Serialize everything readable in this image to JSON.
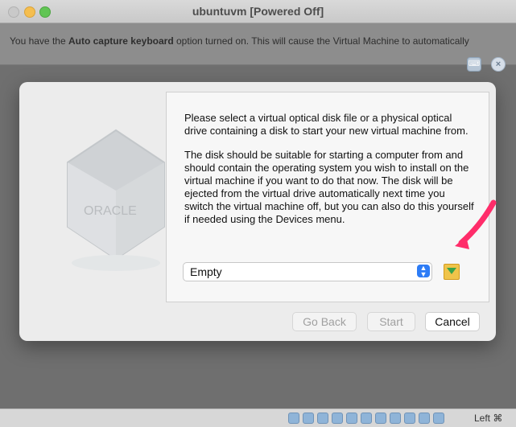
{
  "window": {
    "title": "ubuntuvm [Powered Off]"
  },
  "notice": {
    "text_before": "You have the ",
    "bold_text": "Auto capture keyboard",
    "text_after": " option turned on. This will cause the Virtual Machine to automatically"
  },
  "dialog": {
    "paragraph1": "Please select a virtual optical disk file or a physical optical drive containing a disk to start your new virtual machine from.",
    "paragraph2": "The disk should be suitable for starting a computer from and should contain the operating system you wish to install on the virtual machine if you want to do that now. The disk will be ejected from the virtual drive automatically next time you switch the virtual machine off, but you can also do this yourself if needed using the Devices menu.",
    "select_value": "Empty",
    "buttons": {
      "back": "Go Back",
      "start": "Start",
      "cancel": "Cancel"
    },
    "logo_text": "ORACLE"
  },
  "status_bar": {
    "host_key": "Left ⌘"
  },
  "colors": {
    "annotation_arrow": "#ff2d6a",
    "select_button": "#2d7cf6"
  }
}
